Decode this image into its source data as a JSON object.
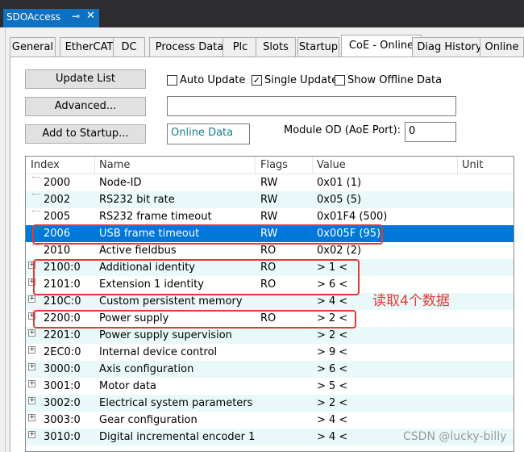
{
  "window": {
    "tab_title": "SDOAccess",
    "pin_glyph": "⊸",
    "close_glyph": "✕"
  },
  "tabs": [
    {
      "label": "General"
    },
    {
      "label": "EtherCAT"
    },
    {
      "label": "DC"
    },
    {
      "label": "Process Data"
    },
    {
      "label": "Plc"
    },
    {
      "label": "Slots"
    },
    {
      "label": "Startup"
    },
    {
      "label": "CoE - Online"
    },
    {
      "label": "Diag History"
    },
    {
      "label": "Online"
    }
  ],
  "active_tab": "CoE - Online",
  "buttons": {
    "update_list": "Update List",
    "advanced": "Advanced...",
    "add_to_startup": "Add to Startup..."
  },
  "options": {
    "auto_update": {
      "label": "Auto Update",
      "checked": false
    },
    "single_update": {
      "label": "Single Update",
      "checked": true
    },
    "show_offline": {
      "label": "Show Offline Data",
      "checked": false
    }
  },
  "fields": {
    "status_value": "",
    "online_data": "Online Data",
    "module_od_label": "Module OD (AoE Port):",
    "module_od_value": "0"
  },
  "table": {
    "columns": [
      "Index",
      "Name",
      "Flags",
      "Value",
      "Unit"
    ],
    "rows": [
      {
        "index": "2000",
        "name": "Node-ID",
        "flags": "RW",
        "value": "0x01 (1)",
        "expandable": false
      },
      {
        "index": "2002",
        "name": "RS232 bit rate",
        "flags": "RW",
        "value": "0x05 (5)",
        "expandable": false
      },
      {
        "index": "2005",
        "name": "RS232 frame timeout",
        "flags": "RW",
        "value": "0x01F4 (500)",
        "expandable": false
      },
      {
        "index": "2006",
        "name": "USB frame timeout",
        "flags": "RW",
        "value": "0x005F (95)",
        "expandable": false,
        "selected": true
      },
      {
        "index": "2010",
        "name": "Active fieldbus",
        "flags": "RO",
        "value": "0x02 (2)",
        "expandable": false
      },
      {
        "index": "2100:0",
        "name": "Additional identity",
        "flags": "RO",
        "value": "> 1 <",
        "expandable": true
      },
      {
        "index": "2101:0",
        "name": "Extension 1 identity",
        "flags": "RO",
        "value": "> 6 <",
        "expandable": true
      },
      {
        "index": "210C:0",
        "name": "Custom persistent memory",
        "flags": "",
        "value": "> 4 <",
        "expandable": true
      },
      {
        "index": "2200:0",
        "name": "Power supply",
        "flags": "RO",
        "value": "> 2 <",
        "expandable": true
      },
      {
        "index": "2201:0",
        "name": "Power supply supervision",
        "flags": "",
        "value": "> 2 <",
        "expandable": true
      },
      {
        "index": "2EC0:0",
        "name": "Internal device control",
        "flags": "",
        "value": "> 9 <",
        "expandable": true
      },
      {
        "index": "3000:0",
        "name": "Axis configuration",
        "flags": "",
        "value": "> 6 <",
        "expandable": true
      },
      {
        "index": "3001:0",
        "name": "Motor data",
        "flags": "",
        "value": "> 5 <",
        "expandable": true
      },
      {
        "index": "3002:0",
        "name": "Electrical system parameters",
        "flags": "",
        "value": "> 2 <",
        "expandable": true
      },
      {
        "index": "3003:0",
        "name": "Gear configuration",
        "flags": "",
        "value": "> 4 <",
        "expandable": true
      },
      {
        "index": "3010:0",
        "name": "Digital incremental encoder 1",
        "flags": "",
        "value": "> 4 <",
        "expandable": true
      }
    ]
  },
  "annotation": {
    "note": "读取4个数据",
    "color": "#e53935"
  },
  "watermark": "CSDN @lucky-billy",
  "colors": {
    "accent": "#0078d7",
    "tab_blue": "#0e70c0",
    "row_alt": "#e9f9f9",
    "dark_bar": "#2d2d30"
  }
}
